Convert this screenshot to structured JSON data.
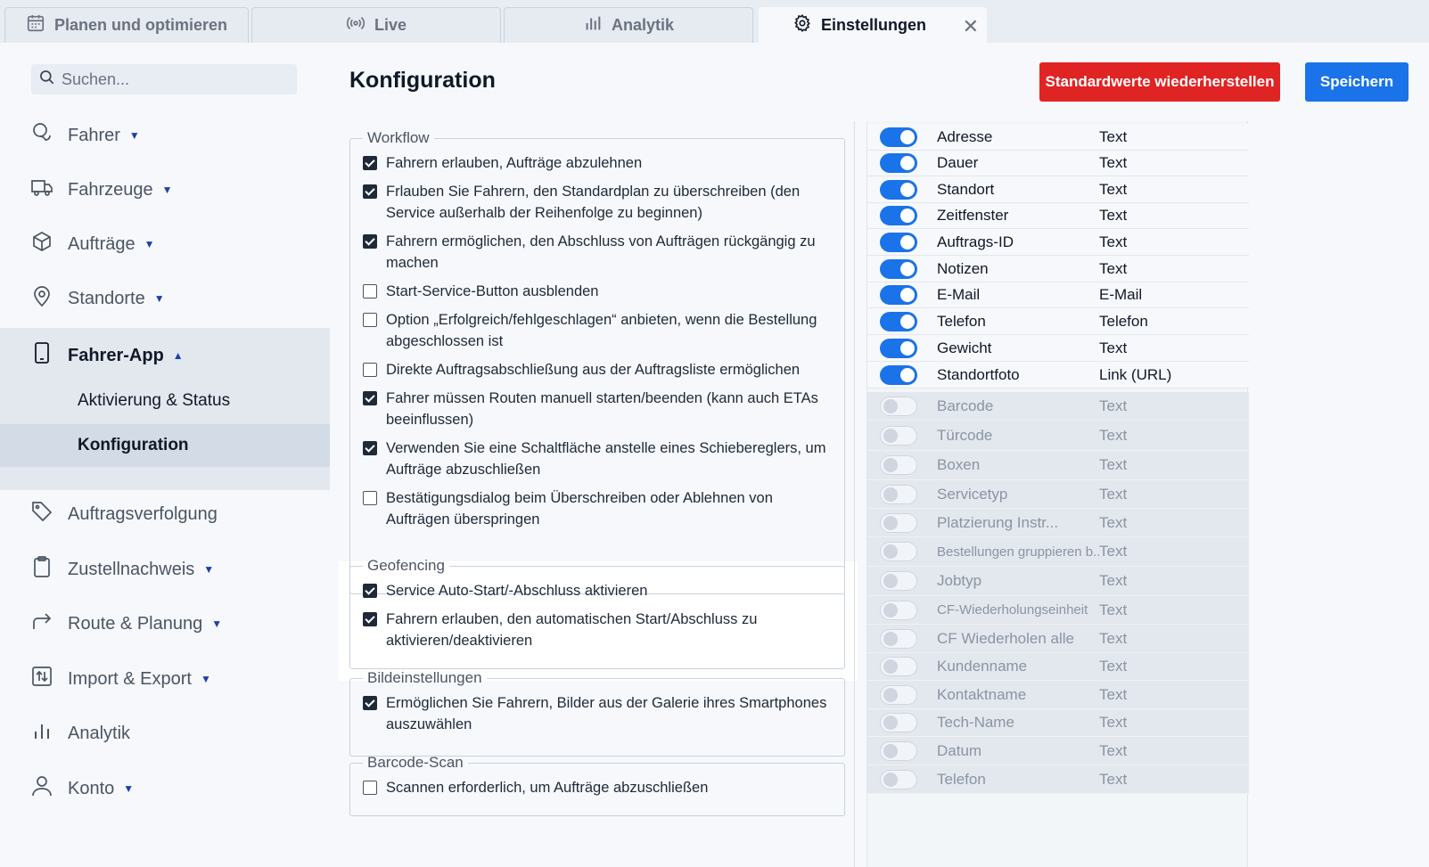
{
  "tabs": [
    {
      "label": "Planen und optimieren",
      "icon": "calendar-icon"
    },
    {
      "label": "Live",
      "icon": "broadcast-icon"
    },
    {
      "label": "Analytik",
      "icon": "bar-chart-icon"
    },
    {
      "label": "Einstellungen",
      "icon": "gear-icon",
      "active": true
    }
  ],
  "sidebar": {
    "search_placeholder": "Suchen...",
    "items": [
      {
        "label": "Fahrer",
        "icon": "users-icon",
        "caret": "▼"
      },
      {
        "label": "Fahrzeuge",
        "icon": "truck-icon",
        "caret": "▼"
      },
      {
        "label": "Aufträge",
        "icon": "box-icon",
        "caret": "▼"
      },
      {
        "label": "Standorte",
        "icon": "map-pin-icon",
        "caret": "▼"
      },
      {
        "label": "Fahrer-App",
        "icon": "smartphone-icon",
        "caret": "▲"
      },
      {
        "label": "Auftragsverfolgung",
        "icon": "tag-icon"
      },
      {
        "label": "Zustellnachweis",
        "icon": "clipboard-icon",
        "caret": "▼"
      },
      {
        "label": "Route & Planung",
        "icon": "route-arrow-icon",
        "caret": "▼"
      },
      {
        "label": "Import & Export",
        "icon": "import-export-icon",
        "caret": "▼"
      },
      {
        "label": "Analytik",
        "icon": "analytics-icon"
      },
      {
        "label": "Konto",
        "icon": "user-icon",
        "caret": "▼"
      }
    ],
    "subitems": [
      {
        "label": "Aktivierung & Status"
      },
      {
        "label": "Konfiguration",
        "active": true
      }
    ]
  },
  "main": {
    "title": "Konfiguration",
    "reset_button": "Standardwerte wiederherstellen",
    "save_button": "Speichern"
  },
  "sections": {
    "workflow": {
      "legend": "Workflow",
      "items": [
        {
          "label": "Fahrern erlauben, Aufträge abzulehnen",
          "checked": true
        },
        {
          "label": "Frlauben Sie Fahrern, den Standardplan zu überschreiben (den Service außerhalb der Reihenfolge zu beginnen)",
          "checked": true
        },
        {
          "label": "Fahrern ermöglichen, den Abschluss von Aufträgen rückgängig zu machen",
          "checked": true
        },
        {
          "label": "Start-Service-Button ausblenden",
          "checked": false
        },
        {
          "label": "Option „Erfolgreich/fehlgeschlagen“ anbieten, wenn die Bestellung abgeschlossen ist",
          "checked": false
        },
        {
          "label": "Direkte Auftragsabschließung aus der Auftragsliste ermöglichen",
          "checked": false
        },
        {
          "label": "Fahrer müssen Routen manuell starten/beenden (kann auch ETAs beeinflussen)",
          "checked": true
        },
        {
          "label": "Verwenden Sie eine Schaltfläche anstelle eines Schiebereglers, um Aufträge abzuschließen",
          "checked": true
        },
        {
          "label": "Bestätigungsdialog beim Überschreiben oder Ablehnen von Aufträgen überspringen",
          "checked": false
        }
      ]
    },
    "geofencing": {
      "legend": "Geofencing",
      "items": [
        {
          "label": "Service Auto-Start/-Abschluss aktivieren",
          "checked": true
        },
        {
          "label": "Fahrern erlauben, den automatischen Start/Abschluss zu aktivieren/deaktivieren",
          "checked": true
        }
      ]
    },
    "images": {
      "legend": "Bildeinstellungen",
      "items": [
        {
          "label": "Ermöglichen Sie Fahrern, Bilder aus der Galerie ihres Smartphones auszuwählen",
          "checked": true
        }
      ]
    },
    "barcode": {
      "legend": "Barcode-Scan",
      "items": [
        {
          "label": "Scannen erforderlich, um Aufträge abzuschließen",
          "checked": false
        }
      ]
    }
  },
  "fields": [
    {
      "name": "Adresse",
      "type": "Text",
      "enabled": true
    },
    {
      "name": "Dauer",
      "type": "Text",
      "enabled": true
    },
    {
      "name": "Standort",
      "type": "Text",
      "enabled": true
    },
    {
      "name": "Zeitfenster",
      "type": "Text",
      "enabled": true
    },
    {
      "name": "Auftrags-ID",
      "type": "Text",
      "enabled": true
    },
    {
      "name": "Notizen",
      "type": "Text",
      "enabled": true
    },
    {
      "name": "E-Mail",
      "type": "E-Mail",
      "enabled": true
    },
    {
      "name": "Telefon",
      "type": "Telefon",
      "enabled": true
    },
    {
      "name": "Gewicht",
      "type": "Text",
      "enabled": true
    },
    {
      "name": "Standortfoto",
      "type": "Link (URL)",
      "enabled": true
    },
    {
      "name": "Barcode",
      "type": "Text",
      "enabled": false
    },
    {
      "name": "Türcode",
      "type": "Text",
      "enabled": false
    },
    {
      "name": "Boxen",
      "type": "Text",
      "enabled": false
    },
    {
      "name": "Servicetyp",
      "type": "Text",
      "enabled": false
    },
    {
      "name": "Platzierung Instr...",
      "type": "Text",
      "enabled": false
    },
    {
      "name": "Bestellungen gruppieren b...",
      "type": "Text",
      "enabled": false
    },
    {
      "name": "Jobtyp",
      "type": "Text",
      "enabled": false
    },
    {
      "name": "CF-Wiederholungseinheit",
      "type": "Text",
      "enabled": false
    },
    {
      "name": "CF Wiederholen alle",
      "type": "Text",
      "enabled": false
    },
    {
      "name": "Kundenname",
      "type": "Text",
      "enabled": false
    },
    {
      "name": "Kontaktname",
      "type": "Text",
      "enabled": false
    },
    {
      "name": "Tech-Name",
      "type": "Text",
      "enabled": false
    },
    {
      "name": "Datum",
      "type": "Text",
      "enabled": false
    },
    {
      "name": "Telefon",
      "type": "Text",
      "enabled": false
    }
  ]
}
